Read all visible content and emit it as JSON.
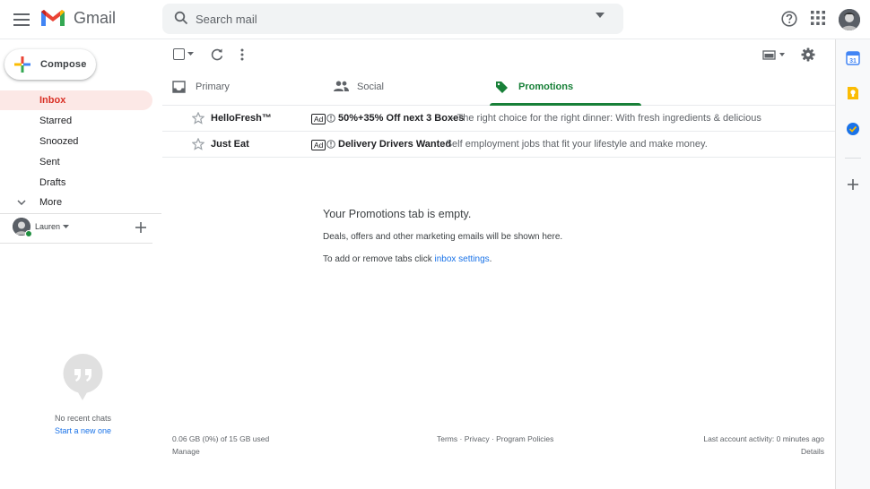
{
  "app": {
    "name": "Gmail"
  },
  "search": {
    "placeholder": "Search mail"
  },
  "compose": {
    "label": "Compose"
  },
  "nav": {
    "items": [
      {
        "label": "Inbox",
        "active": true
      },
      {
        "label": "Starred",
        "active": false
      },
      {
        "label": "Snoozed",
        "active": false
      },
      {
        "label": "Sent",
        "active": false
      },
      {
        "label": "Drafts",
        "active": false
      },
      {
        "label": "More",
        "active": false
      }
    ]
  },
  "hangouts": {
    "user_name": "Lauren",
    "no_chats": "No recent chats",
    "start_chat": "Start a new one"
  },
  "tabs": [
    {
      "label": "Primary",
      "icon": "inbox-icon",
      "selected": false
    },
    {
      "label": "Social",
      "icon": "people-icon",
      "selected": false
    },
    {
      "label": "Promotions",
      "icon": "tag-icon",
      "selected": true
    }
  ],
  "emails": [
    {
      "sender": "HelloFresh™",
      "ad_label": "Ad",
      "subject": "50%+35% Off next 3 Boxes",
      "snippet": "- The right choice for the right dinner: With fresh ingredients & delicious recipes, HelloFresh"
    },
    {
      "sender": "Just Eat",
      "ad_label": "Ad",
      "subject": "Delivery Drivers Wanted",
      "snippet": "- Self employment jobs that fit your lifestyle and make money."
    }
  ],
  "empty_state": {
    "title": "Your Promotions tab is empty.",
    "description": "Deals, offers and other marketing emails will be shown here.",
    "hint_prefix": "To add or remove tabs click ",
    "hint_link": "inbox settings",
    "hint_suffix": "."
  },
  "footer": {
    "storage": "0.06 GB (0%) of 15 GB used",
    "manage": "Manage",
    "terms": "Terms",
    "privacy": "Privacy",
    "program_policies": "Program Policies",
    "separator": " · ",
    "last_activity": "Last account activity: 0 minutes ago",
    "details": "Details"
  },
  "colors": {
    "accent_red": "#d93025",
    "promotions_green": "#188038",
    "link_blue": "#1a73e8"
  },
  "side_panel": {
    "apps": [
      "calendar-icon",
      "keep-icon",
      "tasks-icon"
    ]
  }
}
